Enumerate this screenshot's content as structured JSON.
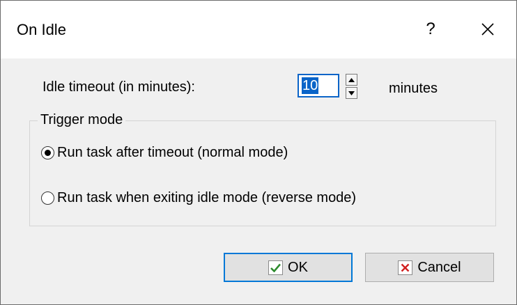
{
  "window": {
    "title": "On Idle",
    "help_glyph": "?",
    "close_icon": "close-icon"
  },
  "idle": {
    "label": "Idle timeout (in minutes):",
    "value": "10",
    "unit": "minutes"
  },
  "trigger": {
    "legend": "Trigger mode",
    "options": [
      {
        "label": "Run task after timeout (normal mode)",
        "checked": true
      },
      {
        "label": "Run task when exiting idle mode (reverse mode)",
        "checked": false
      }
    ]
  },
  "buttons": {
    "ok_label": "OK",
    "ok_icon": "checkmark-icon",
    "cancel_label": "Cancel",
    "cancel_icon": "x-mark-icon"
  },
  "colors": {
    "accent": "#0078d7",
    "check_green": "#2e8b2e",
    "cancel_red": "#d11f1f"
  }
}
